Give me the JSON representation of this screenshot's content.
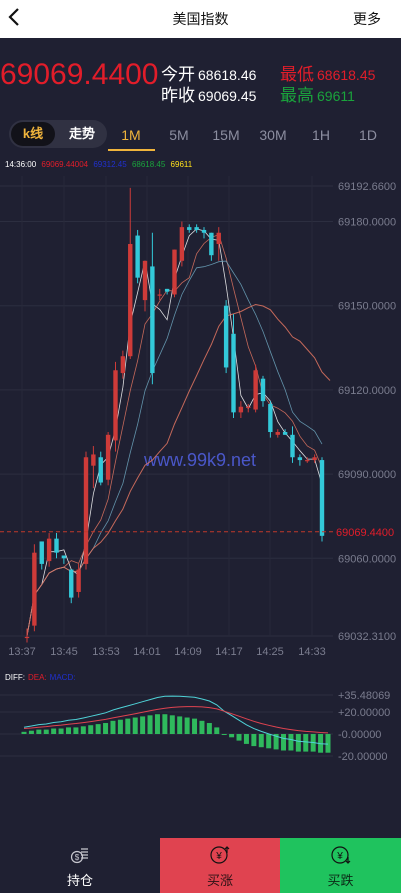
{
  "header": {
    "title": "美国指数",
    "more": "更多"
  },
  "quote": {
    "price": "69069.4400",
    "open_label": "今开",
    "open_value": "68618.46",
    "prev_label": "昨收",
    "prev_value": "69069.45",
    "low_label": "最低",
    "low_value": "68618.45",
    "high_label": "最高",
    "high_value": "69611"
  },
  "mode_toggle": {
    "kline": "k线",
    "trend": "走势"
  },
  "timeframes": [
    "1M",
    "5M",
    "15M",
    "30M",
    "1H",
    "1D"
  ],
  "active_timeframe": "1M",
  "legend": {
    "time": "14:36:00",
    "v1": "69069.44004",
    "v2": "69312.45",
    "v3": "68618.45",
    "v4": "69611"
  },
  "watermark": "www.99k9.net",
  "colors": {
    "up": "#ce3b39",
    "down": "#33c9d9",
    "background": "#1f2032",
    "accent": "#f0b43c",
    "buy": "#e04350",
    "sell": "#1fc35e"
  },
  "chart_data": [
    {
      "type": "candlestick",
      "y_ticks": [
        "69192.6600",
        "69180.0000",
        "69150.0000",
        "69120.0000",
        "69090.0000",
        "69060.0000",
        "69032.3100"
      ],
      "ylim": [
        69032.31,
        69192.66
      ],
      "x_ticks": [
        "13:37",
        "13:45",
        "13:53",
        "14:01",
        "14:09",
        "14:17",
        "14:25",
        "14:33"
      ],
      "current_price_label": "69069.4400",
      "current_price": 69069.44,
      "candles": [
        {
          "o": 69032,
          "h": 69035,
          "l": 69030,
          "c": 69032
        },
        {
          "o": 69036,
          "h": 69065,
          "l": 69034,
          "c": 69062
        },
        {
          "o": 69066,
          "h": 69066,
          "l": 69056,
          "c": 69058
        },
        {
          "o": 69059,
          "h": 69069,
          "l": 69057,
          "c": 69067
        },
        {
          "o": 69067,
          "h": 69069,
          "l": 69060,
          "c": 69062
        },
        {
          "o": 69061,
          "h": 69061,
          "l": 69058,
          "c": 69060
        },
        {
          "o": 69056,
          "h": 69056,
          "l": 69044,
          "c": 69046
        },
        {
          "o": 69048,
          "h": 69058,
          "l": 69046,
          "c": 69056
        },
        {
          "o": 69058,
          "h": 69098,
          "l": 69056,
          "c": 69096
        },
        {
          "o": 69093,
          "h": 69100,
          "l": 69085,
          "c": 69097
        },
        {
          "o": 69096,
          "h": 69098,
          "l": 69086,
          "c": 69087
        },
        {
          "o": 69088,
          "h": 69105,
          "l": 69086,
          "c": 69104
        },
        {
          "o": 69102,
          "h": 69130,
          "l": 69098,
          "c": 69127
        },
        {
          "o": 69126,
          "h": 69134,
          "l": 69124,
          "c": 69132
        },
        {
          "o": 69132,
          "h": 69192,
          "l": 69131,
          "c": 69172
        },
        {
          "o": 69175,
          "h": 69177,
          "l": 69158,
          "c": 69160
        },
        {
          "o": 69152,
          "h": 69166,
          "l": 69148,
          "c": 69166
        },
        {
          "o": 69164,
          "h": 69176,
          "l": 69122,
          "c": 69126
        },
        {
          "o": 69154,
          "h": 69156,
          "l": 69152,
          "c": 69154
        },
        {
          "o": 69156,
          "h": 69156,
          "l": 69154,
          "c": 69155
        },
        {
          "o": 69154,
          "h": 69170,
          "l": 69153,
          "c": 69170
        },
        {
          "o": 69166,
          "h": 69180,
          "l": 69164,
          "c": 69178
        },
        {
          "o": 69178,
          "h": 69179,
          "l": 69176,
          "c": 69177
        },
        {
          "o": 69178,
          "h": 69179,
          "l": 69176,
          "c": 69177
        },
        {
          "o": 69177,
          "h": 69178,
          "l": 69174,
          "c": 69176
        },
        {
          "o": 69176,
          "h": 69176,
          "l": 69166,
          "c": 69168
        },
        {
          "o": 69172,
          "h": 69178,
          "l": 69166,
          "c": 69176
        },
        {
          "o": 69150,
          "h": 69152,
          "l": 69126,
          "c": 69128
        },
        {
          "o": 69140,
          "h": 69147,
          "l": 69110,
          "c": 69112
        },
        {
          "o": 69112,
          "h": 69116,
          "l": 69110,
          "c": 69114
        },
        {
          "o": 69114,
          "h": 69115,
          "l": 69112,
          "c": 69114
        },
        {
          "o": 69113,
          "h": 69129,
          "l": 69112,
          "c": 69127
        },
        {
          "o": 69124,
          "h": 69125,
          "l": 69114,
          "c": 69116
        },
        {
          "o": 69115,
          "h": 69116,
          "l": 69103,
          "c": 69105
        },
        {
          "o": 69104,
          "h": 69106,
          "l": 69103,
          "c": 69105
        },
        {
          "o": 69105,
          "h": 69106,
          "l": 69104,
          "c": 69104
        },
        {
          "o": 69104,
          "h": 69107,
          "l": 69094,
          "c": 69096
        },
        {
          "o": 69096,
          "h": 69097,
          "l": 69093,
          "c": 69095
        },
        {
          "o": 69095,
          "h": 69096,
          "l": 69094,
          "c": 69095
        },
        {
          "o": 69095,
          "h": 69097,
          "l": 69094,
          "c": 69096
        },
        {
          "o": 69095,
          "h": 69096,
          "l": 69066,
          "c": 69068
        }
      ]
    },
    {
      "type": "macd",
      "labels": {
        "diff": "DIFF:",
        "dea": "DEA:",
        "macd": "MACD:"
      },
      "y_ticks": [
        "+35.48069",
        "+20.00000",
        "-0.00000",
        "-20.00000"
      ],
      "ylim": [
        -20,
        35.48
      ],
      "histogram": [
        2,
        3,
        4,
        4,
        5,
        5,
        6,
        6,
        7,
        8,
        9,
        10,
        12,
        13,
        14,
        15,
        16,
        17,
        18,
        18,
        17,
        16,
        15,
        14,
        12,
        10,
        6,
        0,
        -3,
        -6,
        -9,
        -11,
        -12,
        -13,
        -14,
        -15,
        -15,
        -16,
        -16,
        -16,
        -17,
        -17
      ]
    }
  ]
}
